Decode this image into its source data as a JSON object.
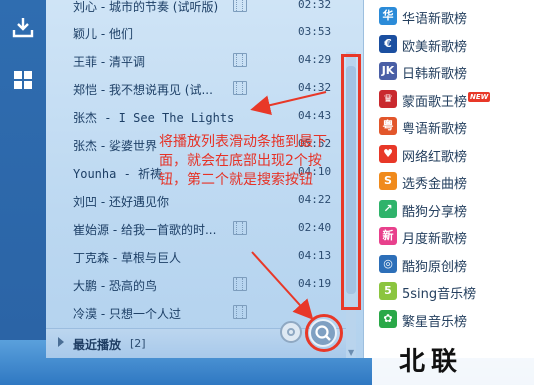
{
  "sidebar": {
    "icons": [
      "download-icon",
      "grid-icon"
    ]
  },
  "playlist": {
    "songs": [
      {
        "title": "刘心 - 城市的节奏 (试听版)",
        "duration": "02:32",
        "mv": true
      },
      {
        "title": "颖儿 - 他们",
        "duration": "03:53",
        "mv": false
      },
      {
        "title": "王菲 - 清平调",
        "duration": "04:29",
        "mv": true
      },
      {
        "title": "郑恺 - 我不想说再见 (试...",
        "duration": "04:32",
        "mv": true
      },
      {
        "title": "张杰 - I See The Lights",
        "duration": "04:43",
        "mv": false
      },
      {
        "title": "张杰 - 娑婆世界",
        "duration": "05:52",
        "mv": false
      },
      {
        "title": "Younha - 祈祷",
        "duration": "04:10",
        "mv": false
      },
      {
        "title": "刘凹 - 还好遇见你",
        "duration": "04:22",
        "mv": false
      },
      {
        "title": "崔始源 - 给我一首歌的时...",
        "duration": "02:40",
        "mv": true
      },
      {
        "title": "丁克森 - 草根与巨人",
        "duration": "04:13",
        "mv": false
      },
      {
        "title": "大鹏 - 恐高的鸟",
        "duration": "04:19",
        "mv": true
      },
      {
        "title": "冷漠 - 只想一个人过",
        "duration": "",
        "mv": true
      }
    ],
    "recent_label": "最近播放",
    "recent_count": "[2]"
  },
  "annotation": {
    "text": "将播放列表滑动条拖到最下面，就会在底部出现2个按钮，第二个就是搜索按钮"
  },
  "charts": {
    "items": [
      {
        "label": "华语新歌榜",
        "logo": "华",
        "color": "#2b8bd8",
        "icon": "chinese-chart-icon"
      },
      {
        "label": "欧美新歌榜",
        "logo": "€",
        "color": "#1b4fa0",
        "icon": "western-chart-icon"
      },
      {
        "label": "日韩新歌榜",
        "logo": "JK",
        "color": "#4a5fa6",
        "icon": "jk-chart-icon"
      },
      {
        "label": "蒙面歌王榜",
        "logo": "♛",
        "color": "#c9292e",
        "icon": "masked-singer-icon",
        "badge": "NEW"
      },
      {
        "label": "粤语新歌榜",
        "logo": "粤",
        "color": "#e2562b",
        "icon": "cantonese-chart-icon"
      },
      {
        "label": "网络红歌榜",
        "logo": "♥",
        "color": "#e83828",
        "icon": "internet-hits-icon"
      },
      {
        "label": "选秀金曲榜",
        "logo": "S",
        "color": "#f08a1c",
        "icon": "talent-show-icon"
      },
      {
        "label": "酷狗分享榜",
        "logo": "↗",
        "color": "#2fb36b",
        "icon": "share-chart-icon"
      },
      {
        "label": "月度新歌榜",
        "logo": "新",
        "color": "#e8408c",
        "icon": "monthly-chart-icon"
      },
      {
        "label": "酷狗原创榜",
        "logo": "◎",
        "color": "#2d6fb8",
        "icon": "original-chart-icon"
      },
      {
        "label": "5sing音乐榜",
        "logo": "5",
        "color": "#8bc53f",
        "icon": "5sing-chart-icon"
      },
      {
        "label": "繁星音乐榜",
        "logo": "✿",
        "color": "#2aa848",
        "icon": "fanxing-chart-icon"
      }
    ]
  },
  "watermark": {
    "text": "北联"
  }
}
